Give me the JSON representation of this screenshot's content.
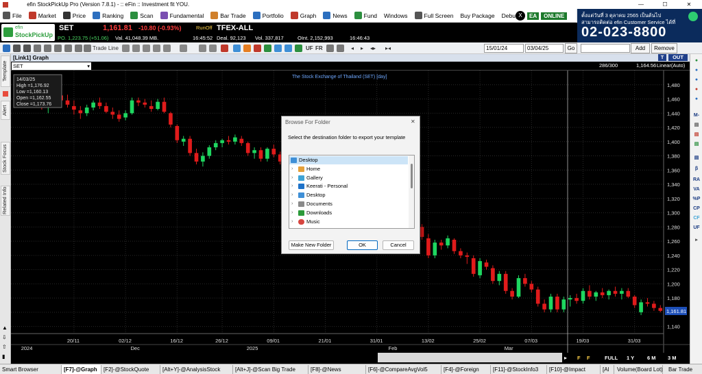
{
  "window": {
    "title": "efin StockPickUp Pro (Version 7.8.1) - :: eFin :: Investment fit YOU.",
    "min": "—",
    "max": "☐",
    "close": "✕"
  },
  "menu": [
    {
      "label": "File",
      "icon": "file-icon",
      "color": "#555"
    },
    {
      "label": "Market",
      "icon": "market-icon",
      "color": "#c0392b"
    },
    {
      "label": "Price",
      "icon": "dollar-icon",
      "color": "#333"
    },
    {
      "label": "Ranking",
      "icon": "ranking-icon",
      "color": "#2c6fbf"
    },
    {
      "label": "Scan",
      "icon": "scan-icon",
      "color": "#2c8f3f"
    },
    {
      "label": "Fundamental",
      "icon": "fundamental-icon",
      "color": "#7a4fb1"
    },
    {
      "label": "Bar Trade",
      "icon": "bar-trade-icon",
      "color": "#d0802b"
    },
    {
      "label": "Portfolio",
      "icon": "portfolio-icon",
      "color": "#2c6fbf"
    },
    {
      "label": "Graph",
      "icon": "graph-icon",
      "color": "#c0392b"
    },
    {
      "label": "News",
      "icon": "news-icon",
      "color": "#2c6fbf"
    },
    {
      "label": "Fund",
      "icon": "fund-icon",
      "color": "#2c8f3f"
    },
    {
      "label": "Windows",
      "icon": "",
      "color": ""
    },
    {
      "label": "Full Screen",
      "icon": "fullscreen-icon",
      "color": "#555"
    },
    {
      "label": "Buy Package",
      "icon": "",
      "color": ""
    },
    {
      "label": "Debug",
      "icon": "",
      "color": ""
    }
  ],
  "badges": {
    "x": "X",
    "ea": "EA",
    "online": "ONLINE"
  },
  "ad": {
    "line1": "ตั้งแต่วันที่ 3 ตุลาคม 2565 เป็นต้นไป",
    "line2": "สามารถติดต่อ efin Customer Service ได้ที่",
    "phone": "02-023-8800"
  },
  "quote": {
    "symbol": "SET",
    "last": "1,161.81",
    "change": "-10.80 (-0.93%)",
    "mode": "RunOff",
    "po": "PO. 1,223.75 (+51.06)",
    "val": "Val. 41,048.39 MB.",
    "time": "16:45:52",
    "symbol2": "TFEX-ALL",
    "deal": "Deal. 92,123",
    "vol": "Vol. 337,817",
    "oi": "OInt. 2,152,993",
    "time2": "16:46:43"
  },
  "toolbar": {
    "trendline": "Trade Line",
    "uf": "UF",
    "fr": "FR",
    "date_from": "15/01/24",
    "date_to": "03/04/25",
    "go": "Go",
    "add": "Add",
    "remove": "Remove"
  },
  "left_tabs": [
    "Template",
    "Alert",
    "Stock Focus",
    "Related Info"
  ],
  "right_panel": [
    "M-",
    "β",
    "RA",
    "VA",
    "%P",
    "CP",
    "CF",
    "UF"
  ],
  "chart": {
    "window_title": "[Link1] Graph",
    "symbol": "SET",
    "t_label": "T",
    "out_label": "OUT",
    "bars_info": "286/300",
    "cursor_value": "1,164.56",
    "scale": "Linear(Auto)",
    "title": "The Stock Exchange of Thailand (SET) [day]",
    "ohlc": {
      "date": "14/03/25",
      "high": "High =1,176.92",
      "low": "Low =1,160.13",
      "open": "Open =1,162.55",
      "close": "Close =1,173.76"
    },
    "last_price": "1,161.81",
    "buttons": [
      "F",
      "F",
      "FULL",
      "1 Y",
      "6 M",
      "3 M"
    ]
  },
  "chart_data": {
    "type": "candlestick",
    "title": "The Stock Exchange of Thailand (SET) [day]",
    "ylim": [
      1130,
      1500
    ],
    "y_ticks": [
      1480,
      1460,
      1440,
      1420,
      1400,
      1380,
      1360,
      1340,
      1320,
      1300,
      1280,
      1260,
      1240,
      1220,
      1200,
      1180,
      1160,
      1140
    ],
    "y_tick_labels": [
      "1,480",
      "1,460",
      "1,440",
      "1,420",
      "1,400",
      "1,380",
      "1,360",
      "1,340",
      "1,320",
      "1,300",
      "1,280",
      "1,260",
      "1,240",
      "1,220",
      "1,200",
      "1,180",
      "1,160",
      "1,140"
    ],
    "x_ticks": [
      {
        "label": "20/11",
        "i": 8
      },
      {
        "label": "02/12",
        "i": 16
      },
      {
        "label": "16/12",
        "i": 24
      },
      {
        "label": "26/12",
        "i": 31
      },
      {
        "label": "09/01",
        "i": 39
      },
      {
        "label": "21/01",
        "i": 47
      },
      {
        "label": "31/01",
        "i": 55
      },
      {
        "label": "13/02",
        "i": 63
      },
      {
        "label": "25/02",
        "i": 71
      },
      {
        "label": "07/03",
        "i": 79
      },
      {
        "label": "19/03",
        "i": 87
      },
      {
        "label": "31/03",
        "i": 95
      }
    ],
    "x_period_labels": [
      {
        "label": "2024",
        "i": 0
      },
      {
        "label": "Dec",
        "i": 17
      },
      {
        "label": "2025",
        "i": 35
      },
      {
        "label": "Feb",
        "i": 57
      },
      {
        "label": "Mar",
        "i": 75
      }
    ],
    "candles": [
      [
        1462,
        1470,
        1450,
        1452
      ],
      [
        1455,
        1465,
        1448,
        1460
      ],
      [
        1460,
        1472,
        1452,
        1455
      ],
      [
        1455,
        1462,
        1445,
        1448
      ],
      [
        1448,
        1458,
        1440,
        1452
      ],
      [
        1452,
        1478,
        1450,
        1468
      ],
      [
        1465,
        1470,
        1452,
        1458
      ],
      [
        1458,
        1466,
        1448,
        1452
      ],
      [
        1450,
        1458,
        1438,
        1445
      ],
      [
        1444,
        1450,
        1432,
        1440
      ],
      [
        1440,
        1452,
        1436,
        1448
      ],
      [
        1448,
        1458,
        1444,
        1455
      ],
      [
        1455,
        1462,
        1446,
        1450
      ],
      [
        1450,
        1455,
        1440,
        1442
      ],
      [
        1442,
        1448,
        1432,
        1438
      ],
      [
        1438,
        1444,
        1428,
        1432
      ],
      [
        1434,
        1444,
        1430,
        1440
      ],
      [
        1440,
        1462,
        1438,
        1458
      ],
      [
        1458,
        1462,
        1450,
        1455
      ],
      [
        1455,
        1460,
        1448,
        1452
      ],
      [
        1450,
        1458,
        1442,
        1446
      ],
      [
        1446,
        1460,
        1444,
        1456
      ],
      [
        1456,
        1462,
        1440,
        1442
      ],
      [
        1440,
        1442,
        1420,
        1424
      ],
      [
        1422,
        1424,
        1398,
        1402
      ],
      [
        1400,
        1408,
        1394,
        1404
      ],
      [
        1404,
        1408,
        1380,
        1384
      ],
      [
        1384,
        1390,
        1368,
        1372
      ],
      [
        1372,
        1385,
        1365,
        1380
      ],
      [
        1380,
        1395,
        1376,
        1392
      ],
      [
        1392,
        1402,
        1388,
        1398
      ],
      [
        1398,
        1404,
        1392,
        1402
      ],
      [
        1402,
        1408,
        1396,
        1400
      ],
      [
        1400,
        1410,
        1396,
        1406
      ],
      [
        1404,
        1408,
        1394,
        1398
      ],
      [
        1398,
        1400,
        1380,
        1384
      ],
      [
        1384,
        1392,
        1376,
        1388
      ],
      [
        1388,
        1392,
        1372,
        1376
      ],
      [
        1376,
        1392,
        1372,
        1390
      ],
      [
        1390,
        1396,
        1378,
        1382
      ],
      [
        1382,
        1386,
        1368,
        1372
      ],
      [
        1372,
        1378,
        1360,
        1364
      ],
      [
        1364,
        1372,
        1356,
        1368
      ],
      [
        1368,
        1374,
        1350,
        1354
      ],
      [
        1354,
        1362,
        1344,
        1358
      ],
      [
        1358,
        1362,
        1340,
        1345
      ],
      [
        1345,
        1352,
        1332,
        1340
      ],
      [
        1340,
        1346,
        1320,
        1324
      ],
      [
        1324,
        1332,
        1312,
        1328
      ],
      [
        1328,
        1334,
        1308,
        1312
      ],
      [
        1312,
        1318,
        1296,
        1300
      ],
      [
        1300,
        1310,
        1290,
        1306
      ],
      [
        1306,
        1312,
        1292,
        1296
      ],
      [
        1296,
        1302,
        1280,
        1286
      ],
      [
        1286,
        1294,
        1274,
        1290
      ],
      [
        1290,
        1300,
        1284,
        1294
      ],
      [
        1294,
        1302,
        1286,
        1288
      ],
      [
        1288,
        1292,
        1276,
        1280
      ],
      [
        1280,
        1288,
        1272,
        1284
      ],
      [
        1284,
        1300,
        1280,
        1296
      ],
      [
        1296,
        1306,
        1288,
        1292
      ],
      [
        1292,
        1296,
        1276,
        1280
      ],
      [
        1280,
        1284,
        1262,
        1266
      ],
      [
        1264,
        1270,
        1236,
        1240
      ],
      [
        1240,
        1262,
        1236,
        1258
      ],
      [
        1258,
        1262,
        1248,
        1254
      ],
      [
        1254,
        1268,
        1250,
        1264
      ],
      [
        1262,
        1264,
        1242,
        1246
      ],
      [
        1246,
        1250,
        1236,
        1240
      ],
      [
        1240,
        1244,
        1228,
        1238
      ],
      [
        1236,
        1240,
        1210,
        1214
      ],
      [
        1212,
        1236,
        1208,
        1232
      ],
      [
        1230,
        1234,
        1220,
        1224
      ],
      [
        1222,
        1226,
        1200,
        1204
      ],
      [
        1204,
        1218,
        1198,
        1214
      ],
      [
        1214,
        1218,
        1186,
        1190
      ],
      [
        1190,
        1194,
        1178,
        1182
      ],
      [
        1182,
        1212,
        1180,
        1208
      ],
      [
        1208,
        1214,
        1196,
        1200
      ],
      [
        1200,
        1204,
        1188,
        1192
      ],
      [
        1192,
        1196,
        1168,
        1172
      ],
      [
        1172,
        1178,
        1160,
        1164
      ],
      [
        1164,
        1186,
        1160,
        1182
      ],
      [
        1182,
        1186,
        1160,
        1164
      ],
      [
        1164,
        1182,
        1160,
        1178
      ],
      [
        1178,
        1184,
        1168,
        1180
      ],
      [
        1180,
        1186,
        1172,
        1176
      ],
      [
        1176,
        1194,
        1172,
        1190
      ],
      [
        1190,
        1198,
        1178,
        1182
      ],
      [
        1182,
        1190,
        1176,
        1188
      ],
      [
        1188,
        1194,
        1180,
        1184
      ],
      [
        1184,
        1192,
        1178,
        1190
      ],
      [
        1190,
        1196,
        1182,
        1186
      ],
      [
        1186,
        1194,
        1178,
        1190
      ],
      [
        1190,
        1194,
        1180,
        1182
      ],
      [
        1182,
        1184,
        1166,
        1170
      ],
      [
        1160,
        1178,
        1156,
        1174
      ],
      [
        1174,
        1180,
        1168,
        1172
      ],
      [
        1172,
        1176,
        1162,
        1166
      ],
      [
        1166,
        1170,
        1160,
        1162
      ]
    ]
  },
  "dialog": {
    "title": "Browse For Folder",
    "close": "✕",
    "instruction": "Select the destination folder to export your template",
    "tree": [
      {
        "label": "Desktop",
        "level": 0,
        "selected": true,
        "icon": "desktop-folder-icon",
        "color": "#3f8fd6"
      },
      {
        "label": "Home",
        "level": 1,
        "icon": "home-icon",
        "color": "#e5a13a"
      },
      {
        "label": "Gallery",
        "level": 1,
        "icon": "gallery-icon",
        "color": "#3fa4d6"
      },
      {
        "label": "Keerati - Personal",
        "level": 1,
        "icon": "onedrive-icon",
        "color": "#1f73c9"
      },
      {
        "label": "Desktop",
        "level": 1,
        "icon": "desktop-folder-icon",
        "color": "#3f8fd6"
      },
      {
        "label": "Documents",
        "level": 1,
        "icon": "documents-icon",
        "color": "#8a8a8a"
      },
      {
        "label": "Downloads",
        "level": 1,
        "icon": "downloads-icon",
        "color": "#2c9a3a"
      },
      {
        "label": "Music",
        "level": 1,
        "icon": "music-icon",
        "color": "#d6453f"
      }
    ],
    "new_folder": "Make New Folder",
    "ok": "OK",
    "cancel": "Cancel"
  },
  "taskbar": [
    {
      "label": "Smart Browser",
      "active": false
    },
    {
      "label": "[F7]-@Graph",
      "active": true
    },
    {
      "label": "[F2]-@StockQuote",
      "active": false
    },
    {
      "label": "[Alt+Y]-@AnalysisStock",
      "active": false
    },
    {
      "label": "[Alt+J]-@Scan Big Trade",
      "active": false
    },
    {
      "label": "[F8]-@News",
      "active": false
    },
    {
      "label": "[F6]-@CompareAvgVol5",
      "active": false
    },
    {
      "label": "[F4]-@Foreign",
      "active": false
    },
    {
      "label": "[F11]-@StockInfo3",
      "active": false
    },
    {
      "label": "[F10]-@Impact",
      "active": false
    },
    {
      "label": "[Al",
      "active": false
    }
  ],
  "taskbar_right": {
    "volume": "Volume(Board Lot)",
    "bartrade": "Bar Trade"
  }
}
